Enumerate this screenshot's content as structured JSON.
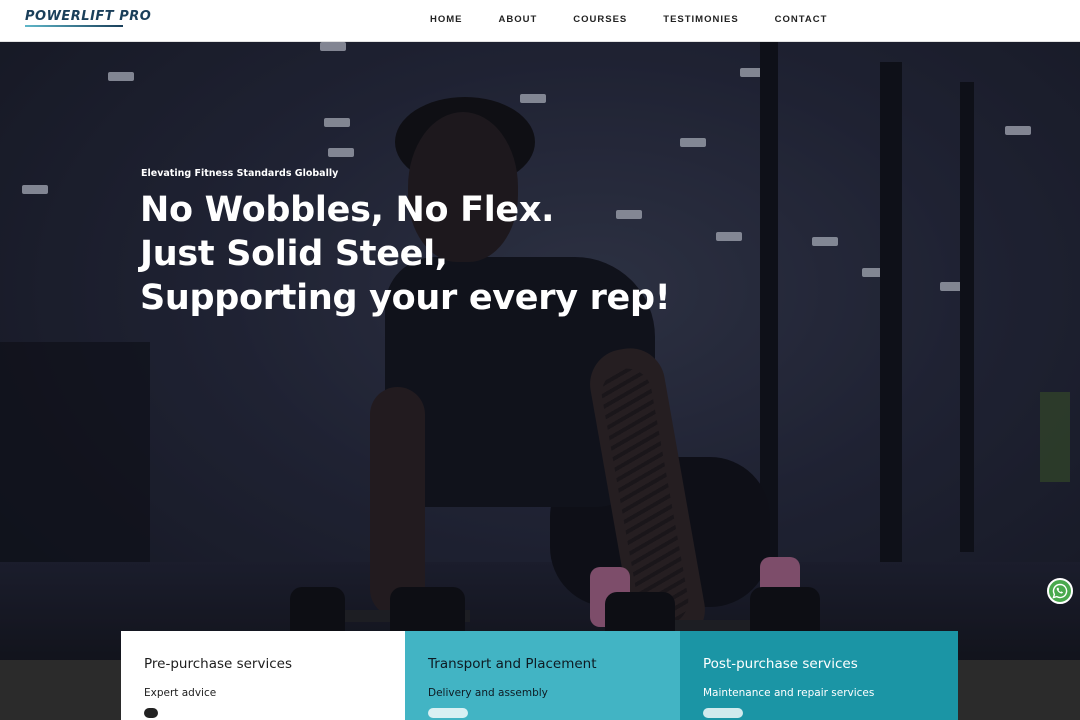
{
  "brand": {
    "name": "POWERLIFT PRO"
  },
  "nav": {
    "items": [
      {
        "label": "HOME"
      },
      {
        "label": "ABOUT"
      },
      {
        "label": "COURSES"
      },
      {
        "label": "TESTIMONIES"
      },
      {
        "label": "CONTACT"
      }
    ]
  },
  "hero": {
    "tagline": "Elevating Fitness Standards Globally",
    "title_lines": [
      "No Wobbles, No Flex.",
      "Just Solid Steel,",
      "Supporting your every rep!"
    ]
  },
  "services": [
    {
      "title": "Pre-purchase services",
      "subtitle": "Expert advice",
      "background": "#ffffff"
    },
    {
      "title": "Transport and Placement",
      "subtitle": "Delivery and assembly",
      "background": "#42b4c4"
    },
    {
      "title": "Post-purchase services",
      "subtitle": "Maintenance and repair services",
      "background": "#1b95a5"
    }
  ],
  "floating": {
    "icon": "whatsapp-icon",
    "color": "#49a94d"
  },
  "colors": {
    "accent": "#42b4c4",
    "accent_dark": "#1b95a5",
    "logo": "#1a3f5a"
  }
}
